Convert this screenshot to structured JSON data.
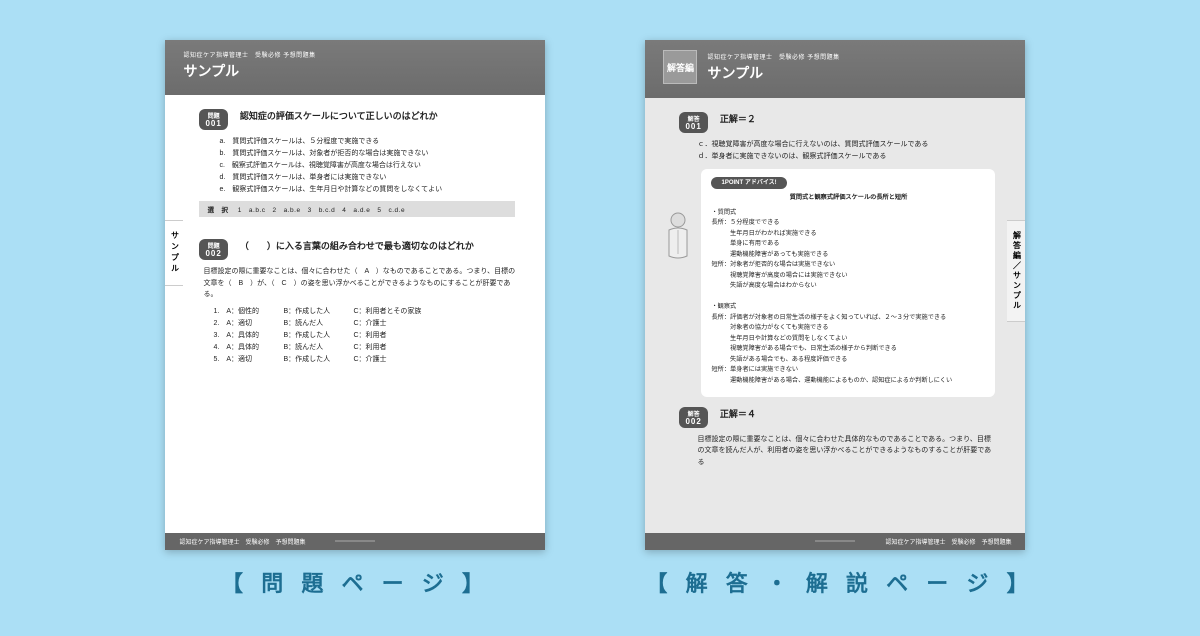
{
  "captions": {
    "left": "【 問 題 ペ ー ジ 】",
    "right": "【 解 答 ・ 解 説 ペ ー ジ 】"
  },
  "leftPage": {
    "header": {
      "sub": "認知症ケア指導管理士　受験必修 予想問題集",
      "title": "サンプル"
    },
    "sideTab": "サンプル",
    "q1": {
      "badgeTop": "問題",
      "badgeNum": "001",
      "title": "認知症の評価スケールについて正しいのはどれか",
      "opts": {
        "a": "a.　質問式評価スケールは、５分程度で実施できる",
        "b": "b.　質問式評価スケールは、対象者が拒否的な場合は実施できない",
        "c": "c.　観察式評価スケールは、視聴覚障害が高度な場合は行えない",
        "d": "d.　質問式評価スケールは、単身者には実施できない",
        "e": "e.　観察式評価スケールは、生年月日や計算などの質問をしなくてよい"
      },
      "choiceLabel": "選　択",
      "choiceLine": "1　a.b.c　2　a.b.e　3　b.c.d　4　a.d.e　5　c.d.e"
    },
    "q2": {
      "badgeTop": "問題",
      "badgeNum": "002",
      "title": "（　　）に入る言葉の組み合わせで最も適切なのはどれか",
      "desc": "目標設定の際に重要なことは、個々に合わせた（　A　）なものであることである。つまり、目標の文章を（　B　）が、（　C　）の姿を思い浮かべることができるようなものにすることが肝要である。",
      "rows": [
        {
          "n": "1.",
          "a": "A：個性的",
          "b": "B：作成した人",
          "c": "C：利用者とその家族"
        },
        {
          "n": "2.",
          "a": "A：適切",
          "b": "B：読んだ人",
          "c": "C：介護士"
        },
        {
          "n": "3.",
          "a": "A：具体的",
          "b": "B：作成した人",
          "c": "C：利用者"
        },
        {
          "n": "4.",
          "a": "A：具体的",
          "b": "B：読んだ人",
          "c": "C：利用者"
        },
        {
          "n": "5.",
          "a": "A：適切",
          "b": "B：作成した人",
          "c": "C：介護士"
        }
      ]
    },
    "footer": "認知症ケア指導管理士　受験必修　予想問題集"
  },
  "rightPage": {
    "header": {
      "box": "解答編",
      "sub": "認知症ケア指導管理士　受験必修 予想問題集",
      "title": "サンプル"
    },
    "sideTab": "解答編／サンプル",
    "a1": {
      "badgeTop": "解答",
      "badgeNum": "001",
      "correct": "正解＝２",
      "explain": {
        "c": "ｃ．視聴覚障害が高度な場合に行えないのは、質問式評価スケールである",
        "d": "ｄ．単身者に実施できないのは、観察式評価スケールである"
      },
      "point": {
        "hdr": "1POINT アドバイス!",
        "lead": "質問式と観察式評価スケールの長所と短所",
        "body": [
          "・質問式",
          "長所：５分程度でできる",
          "　　　生年月日がわかれば実施できる",
          "　　　単身に有用である",
          "　　　運動機能障害があっても実施できる",
          "短所：対象者が拒否的な場合は実施できない",
          "　　　視聴覚障害が高度の場合には実施できない",
          "　　　失語が高度な場合はわからない",
          "",
          "・観察式",
          "長所：評価者が対象者の日常生活の様子をよく知っていれば、２～３分で実施できる",
          "　　　対象者の協力がなくても実施できる",
          "　　　生年月日や計算などの質問をしなくてよい",
          "　　　視聴覚障害がある場合でも、日常生活の様子から判断できる",
          "　　　失語がある場合でも、ある程度評価できる",
          "短所：単身者には実施できない",
          "　　　運動機能障害がある場合、運動機能によるものか、認知症によるか判断しにくい"
        ]
      }
    },
    "a2": {
      "badgeTop": "解答",
      "badgeNum": "002",
      "correct": "正解＝４",
      "explain": "目標設定の際に重要なことは、個々に合わせた具体的なものであることである。つまり、目標の文章を読んだ人が、利用者の姿を思い浮かべることができるようなものすることが肝要である"
    },
    "footer": "認知症ケア指導管理士　受験必修　予想問題集"
  }
}
